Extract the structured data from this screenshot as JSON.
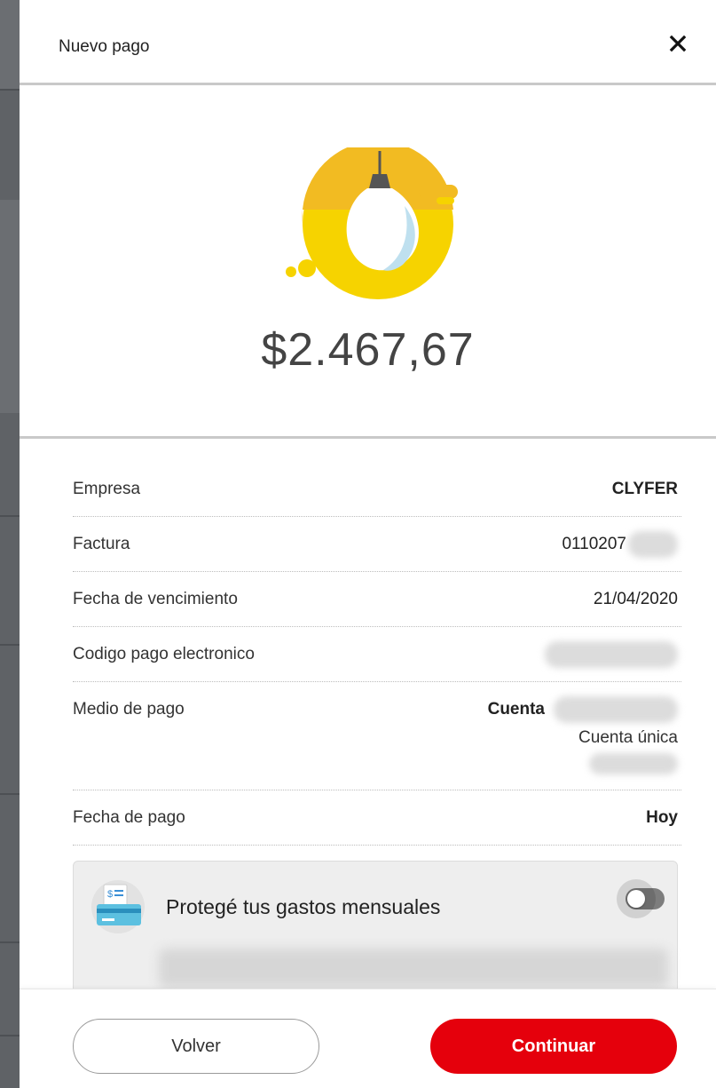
{
  "header": {
    "title": "Nuevo pago"
  },
  "hero": {
    "amount": "$2.467,67",
    "icon": "lightbulb-icon"
  },
  "details": {
    "empresa_label": "Empresa",
    "empresa_value": "CLYFER",
    "factura_label": "Factura",
    "factura_value": "0110207",
    "vencimiento_label": "Fecha de vencimiento",
    "vencimiento_value": "21/04/2020",
    "codigo_label": "Codigo pago electronico",
    "medio_label": "Medio de pago",
    "medio_value": "Cuenta",
    "medio_sub": "Cuenta única",
    "fecha_pago_label": "Fecha de pago",
    "fecha_pago_value": "Hoy"
  },
  "promo": {
    "title": "Protegé tus gastos mensuales",
    "toggle_on": false
  },
  "footer": {
    "back_label": "Volver",
    "continue_label": "Continuar"
  },
  "colors": {
    "accent": "#e5000c",
    "bulb_yellow": "#f4c20d"
  }
}
